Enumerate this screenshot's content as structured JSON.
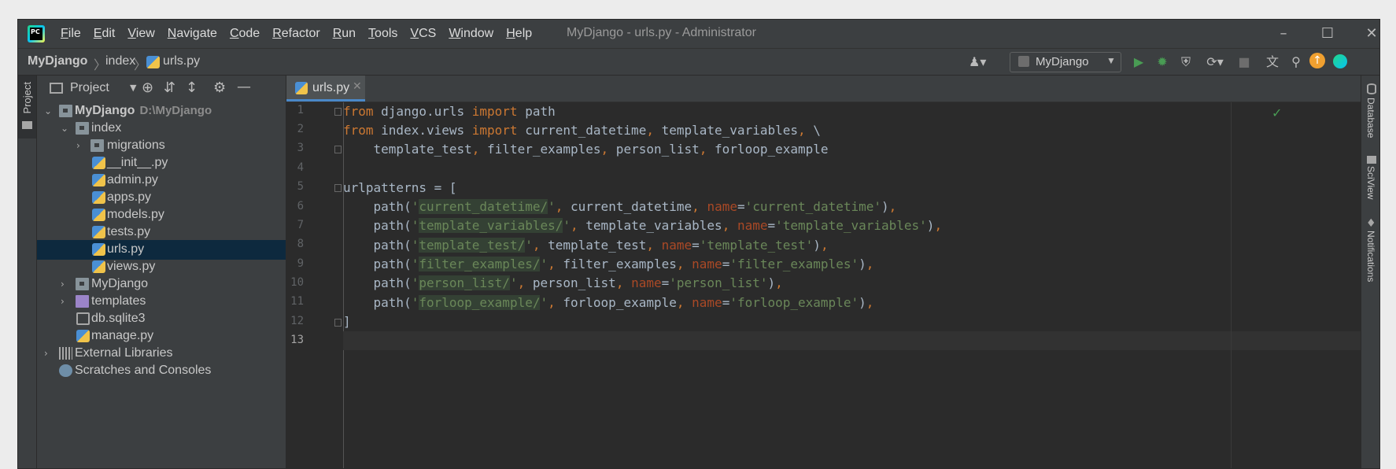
{
  "app": {
    "window_title": "MyDjango - urls.py - Administrator",
    "logo_text": "PC",
    "menu": [
      "File",
      "Edit",
      "View",
      "Navigate",
      "Code",
      "Refactor",
      "Run",
      "Tools",
      "VCS",
      "Window",
      "Help"
    ]
  },
  "breadcrumb": {
    "project": "MyDjango",
    "folder": "index",
    "file": "urls.py"
  },
  "toolbar": {
    "run_config": "MyDjango"
  },
  "stripes": {
    "left_project": "Project",
    "right_database": "Database",
    "right_sciview": "SciView",
    "right_notifications": "Notifications"
  },
  "project_panel": {
    "title": "Project",
    "tree": [
      {
        "label": "MyDjango",
        "sub": "D:\\MyDjango"
      },
      {
        "label": "index"
      },
      {
        "label": "migrations"
      },
      {
        "label": "__init__.py"
      },
      {
        "label": "admin.py"
      },
      {
        "label": "apps.py"
      },
      {
        "label": "models.py"
      },
      {
        "label": "tests.py"
      },
      {
        "label": "urls.py"
      },
      {
        "label": "views.py"
      },
      {
        "label": "MyDjango"
      },
      {
        "label": "templates"
      },
      {
        "label": "db.sqlite3"
      },
      {
        "label": "manage.py"
      },
      {
        "label": "External Libraries"
      },
      {
        "label": "Scratches and Consoles"
      }
    ]
  },
  "editor": {
    "tab_label": "urls.py",
    "line_numbers": [
      "1",
      "2",
      "3",
      "4",
      "5",
      "6",
      "7",
      "8",
      "9",
      "10",
      "11",
      "12",
      "13"
    ],
    "code": {
      "l1": {
        "kw1": "from",
        "t1": " django.urls ",
        "kw2": "import",
        "t2": " path"
      },
      "l2": {
        "kw1": "from",
        "t1": " index.views ",
        "kw2": "import",
        "t2": " current_datetime",
        "c1": ",",
        "t3": " template_variables",
        "c2": ",",
        "t4": " \\"
      },
      "l3": {
        "t1": "    template_test",
        "c1": ",",
        "t2": " filter_examples",
        "c2": ",",
        "t3": " person_list",
        "c3": ",",
        "t4": " forloop_example"
      },
      "l5": {
        "t1": "urlpatterns = ["
      },
      "routes": [
        {
          "pre": "    path(",
          "q1": "'",
          "route": "current_datetime/",
          "q2": "'",
          "c1": ",",
          "view": " current_datetime",
          "c2": ",",
          "sp": " ",
          "name_kw": "name",
          "eq": "=",
          "name_val": "'current_datetime'",
          "close": ")",
          "c3": ","
        },
        {
          "pre": "    path(",
          "q1": "'",
          "route": "template_variables/",
          "q2": "'",
          "c1": ",",
          "view": " template_variables",
          "c2": ",",
          "sp": " ",
          "name_kw": "name",
          "eq": "=",
          "name_val": "'template_variables'",
          "close": ")",
          "c3": ","
        },
        {
          "pre": "    path(",
          "q1": "'",
          "route": "template_test/",
          "q2": "'",
          "c1": ",",
          "view": " template_test",
          "c2": ",",
          "sp": " ",
          "name_kw": "name",
          "eq": "=",
          "name_val": "'template_test'",
          "close": ")",
          "c3": ","
        },
        {
          "pre": "    path(",
          "q1": "'",
          "route": "filter_examples/",
          "q2": "'",
          "c1": ",",
          "view": " filter_examples",
          "c2": ",",
          "sp": " ",
          "name_kw": "name",
          "eq": "=",
          "name_val": "'filter_examples'",
          "close": ")",
          "c3": ","
        },
        {
          "pre": "    path(",
          "q1": "'",
          "route": "person_list/",
          "q2": "'",
          "c1": ",",
          "view": " person_list",
          "c2": ",",
          "sp": " ",
          "name_kw": "name",
          "eq": "=",
          "name_val": "'person_list'",
          "close": ")",
          "c3": ","
        },
        {
          "pre": "    path(",
          "q1": "'",
          "route": "forloop_example/",
          "q2": "'",
          "c1": ",",
          "view": " forloop_example",
          "c2": ",",
          "sp": " ",
          "name_kw": "name",
          "eq": "=",
          "name_val": "'forloop_example'",
          "close": ")",
          "c3": ","
        }
      ],
      "l12": {
        "t1": "]"
      }
    }
  },
  "colors": {
    "keyword": "#cc7832",
    "string": "#6a8759",
    "param": "#aa4926",
    "text": "#a9b7c6",
    "selection": "#0d293e"
  }
}
